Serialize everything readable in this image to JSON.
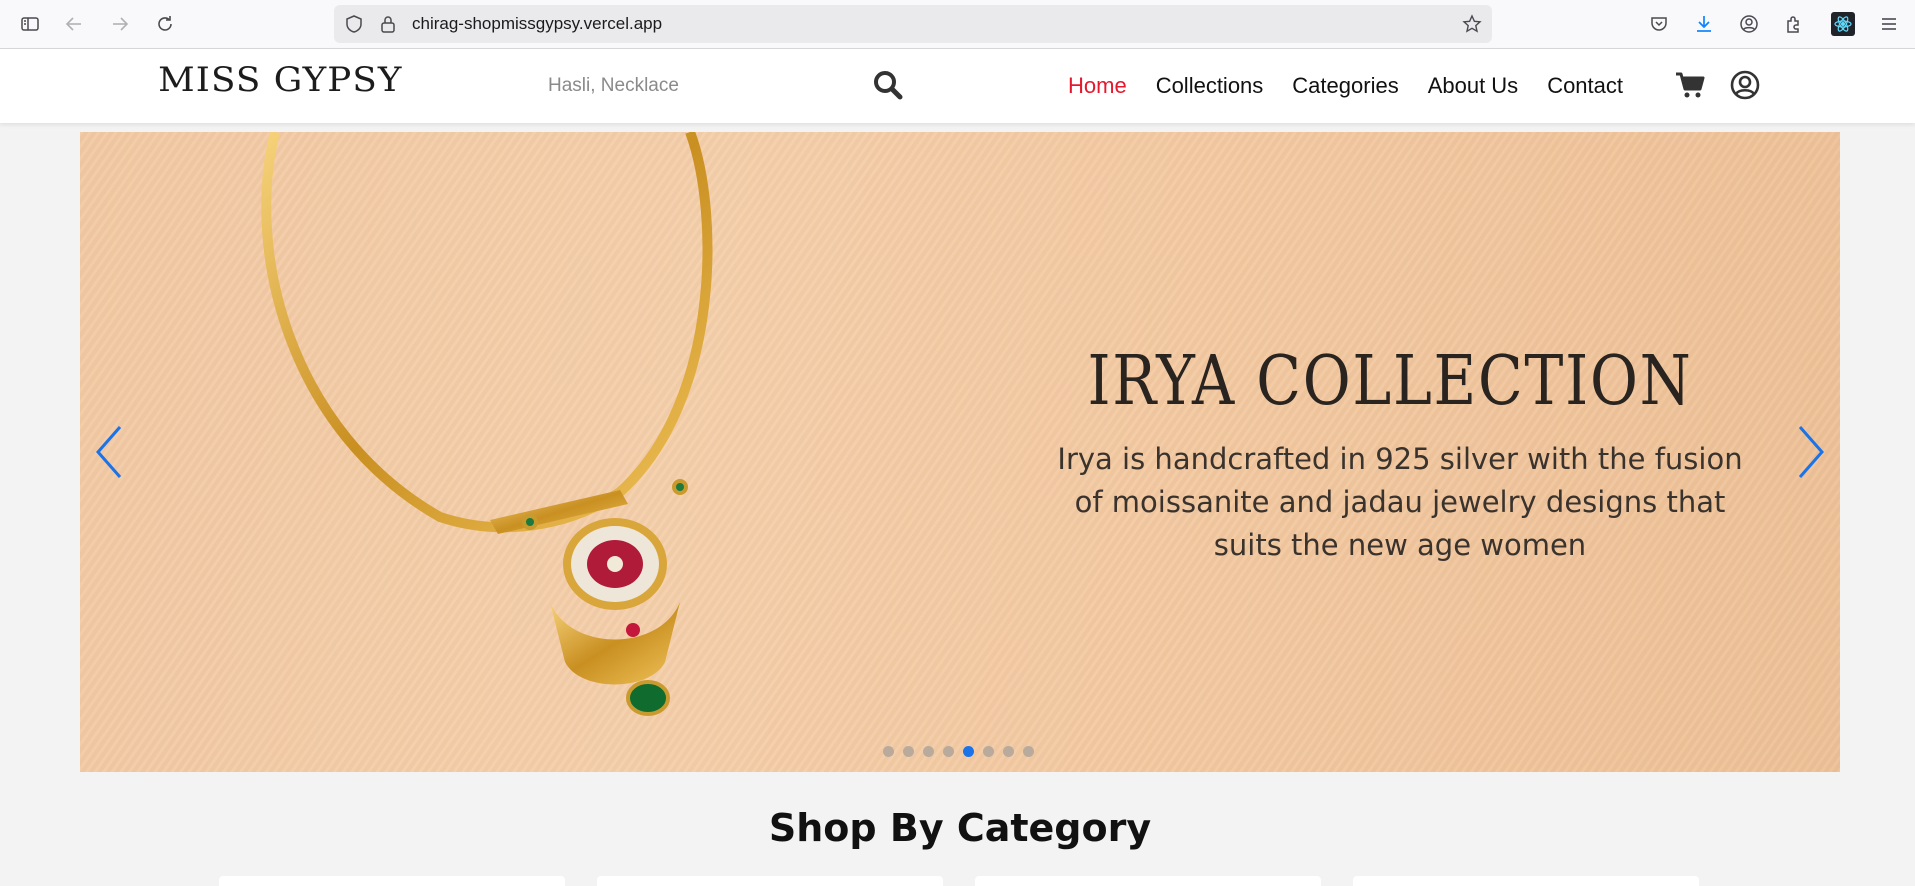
{
  "browser": {
    "url": "chirag-shopmissgypsy.vercel.app"
  },
  "header": {
    "logo_text": "MISS GYPSY",
    "search_placeholder": "Hasli, Necklace",
    "nav": [
      {
        "label": "Home",
        "active": true
      },
      {
        "label": "Collections",
        "active": false
      },
      {
        "label": "Categories",
        "active": false
      },
      {
        "label": "About Us",
        "active": false
      },
      {
        "label": "Contact",
        "active": false
      }
    ]
  },
  "carousel": {
    "title": "IRYA COLLECTION",
    "description_lines": [
      "Irya is handcrafted in 925 silver with the fusion",
      "of moissanite and jadau jewelry designs that",
      "suits the new age women"
    ],
    "slide_count": 8,
    "active_index": 4,
    "colors": {
      "accent": "#1a73e8",
      "nav_active": "#e5192e"
    }
  },
  "section": {
    "title": "Shop By Category"
  },
  "icons": [
    "sidebar-icon",
    "back-icon",
    "forward-icon",
    "reload-icon",
    "shield-icon",
    "lock-icon",
    "star-icon",
    "pocket-icon",
    "download-icon",
    "account-icon",
    "extensions-icon",
    "react-devtools-icon",
    "menu-icon",
    "search-icon",
    "cart-icon",
    "user-icon",
    "chevron-left-icon",
    "chevron-right-icon"
  ]
}
